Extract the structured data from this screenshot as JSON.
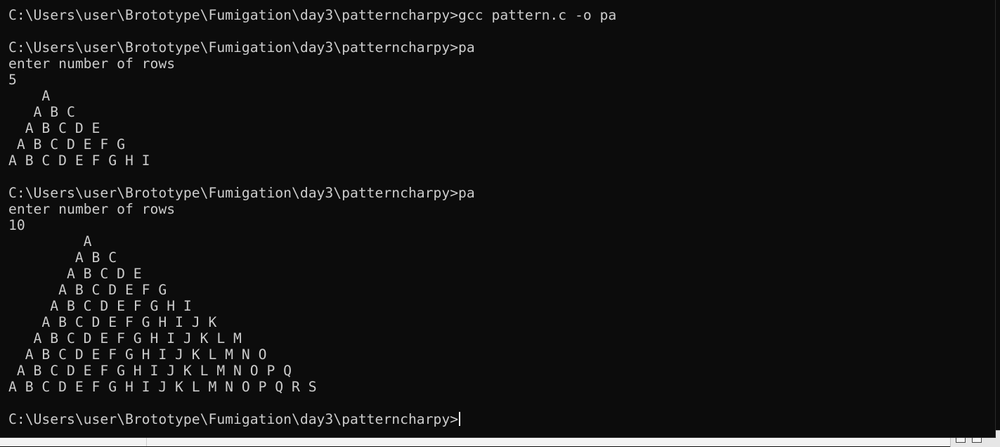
{
  "terminal": {
    "lines": [
      "C:\\Users\\user\\Brototype\\Fumigation\\day3\\patterncharpy>gcc pattern.c -o pa",
      "",
      "C:\\Users\\user\\Brototype\\Fumigation\\day3\\patterncharpy>pa",
      "enter number of rows",
      "5",
      "    A",
      "   A B C",
      "  A B C D E",
      " A B C D E F G",
      "A B C D E F G H I",
      "",
      "C:\\Users\\user\\Brototype\\Fumigation\\day3\\patterncharpy>pa",
      "enter number of rows",
      "10",
      "         A",
      "        A B C",
      "       A B C D E",
      "      A B C D E F G",
      "     A B C D E F G H I",
      "    A B C D E F G H I J K",
      "   A B C D E F G H I J K L M",
      "  A B C D E F G H I J K L M N O",
      " A B C D E F G H I J K L M N O P Q",
      "A B C D E F G H I J K L M N O P Q R S",
      ""
    ],
    "prompt": "C:\\Users\\user\\Brototype\\Fumigation\\day3\\patterncharpy>"
  },
  "colors": {
    "background": "#0c0c0c",
    "text": "#cccccc",
    "cursor": "#ffffff"
  },
  "icons": {
    "corner_left": "window-icon",
    "corner_right": "window-icon"
  }
}
